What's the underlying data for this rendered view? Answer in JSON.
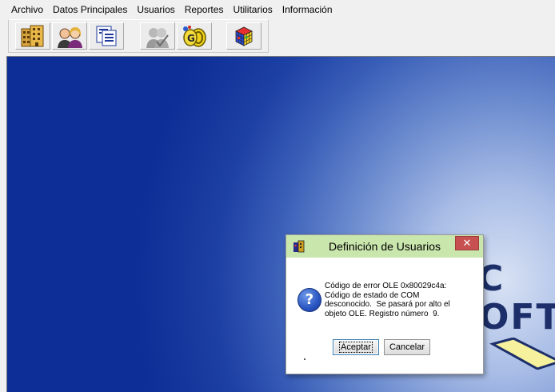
{
  "menubar": {
    "items": [
      "Archivo",
      "Datos Principales",
      "Usuarios",
      "Reportes",
      "Utilitarios",
      "Información"
    ]
  },
  "toolbar": {
    "buttons": [
      {
        "icon": "building-icon"
      },
      {
        "icon": "users-icon"
      },
      {
        "icon": "document-icon"
      },
      {
        "icon": "user-check-icon"
      },
      {
        "icon": "coins-icon"
      },
      {
        "icon": "rubik-cube-icon"
      }
    ]
  },
  "background_logo": {
    "fragments": [
      "C",
      "OFT"
    ]
  },
  "dialog": {
    "title": "Definición de Usuarios",
    "close_label": "✕",
    "message_lines": [
      "Código de error OLE 0x80029c4a:",
      "Código de estado de COM",
      "desconocido.  Se pasará por alto el",
      "objeto OLE. Registro número  9."
    ],
    "ok_label": "Aceptar",
    "cancel_label": "Cancelar"
  },
  "colors": {
    "titlebar": "#c9e6ad",
    "close_button": "#c75050",
    "workspace_dark": "#0c2e96",
    "workspace_light": "#d8e2f4"
  }
}
